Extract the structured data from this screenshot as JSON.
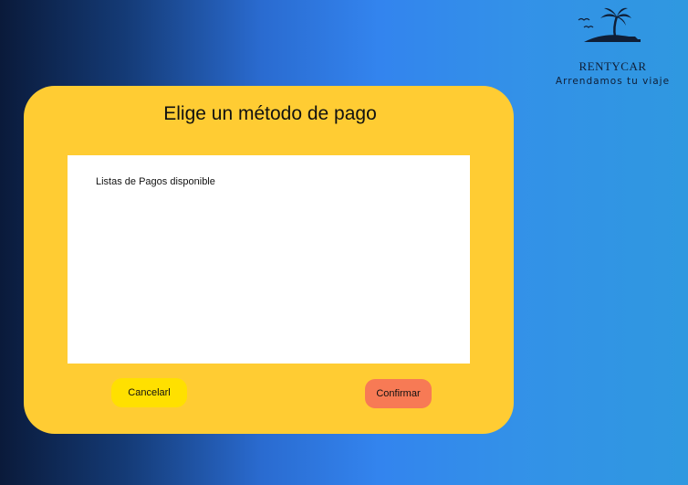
{
  "brand": {
    "name": "RENTYCAR",
    "tagline": "Arrendamos tu viaje",
    "logo_icon": "palm-island-icon"
  },
  "dialog": {
    "title": "Elige un método de pago",
    "list_caption": "Listas de Pagos disponible",
    "cancel_label": "Cancelarl",
    "confirm_label": "Confirmar"
  },
  "colors": {
    "dialog_background": "#ffcc33",
    "cancel_button": "#ffe000",
    "confirm_button": "#f77a55",
    "panel_background": "#ffffff"
  }
}
